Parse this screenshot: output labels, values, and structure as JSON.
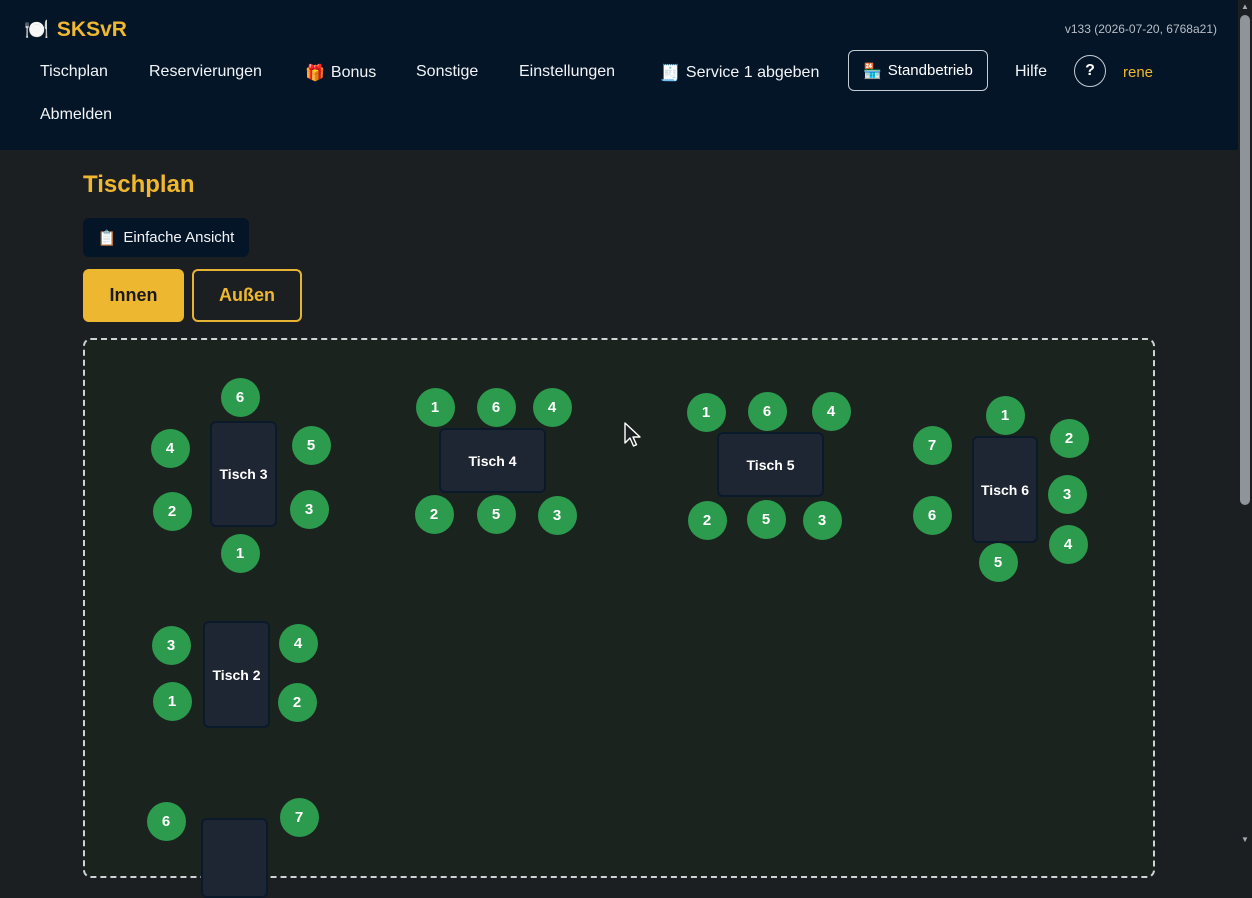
{
  "app": {
    "icon": "🍽️",
    "title": "SKSvR",
    "version": "v133 (2026-07-20, 6768a21)",
    "user": "rene"
  },
  "nav": {
    "tischplan": "Tischplan",
    "reservierungen": "Reservierungen",
    "bonus_icon": "🎁",
    "bonus": "Bonus",
    "sonstige": "Sonstige",
    "einstellungen": "Einstellungen",
    "service_icon": "🧾",
    "service": "Service 1 abgeben",
    "standbetrieb_icon": "🏪",
    "standbetrieb": "Standbetrieb",
    "hilfe": "Hilfe",
    "help_symbol": "?",
    "abmelden": "Abmelden"
  },
  "page": {
    "title": "Tischplan",
    "simple_view_icon": "📋",
    "simple_view": "Einfache Ansicht"
  },
  "tabs": {
    "innen": "Innen",
    "aussen": "Außen",
    "active": "innen"
  },
  "tables": {
    "t3": {
      "name": "Tisch 3",
      "seats": [
        "6",
        "4",
        "5",
        "2",
        "3",
        "1"
      ]
    },
    "t4": {
      "name": "Tisch 4",
      "seats": [
        "1",
        "6",
        "4",
        "2",
        "5",
        "3"
      ]
    },
    "t5": {
      "name": "Tisch 5",
      "seats": [
        "1",
        "6",
        "4",
        "2",
        "5",
        "3"
      ]
    },
    "t6": {
      "name": "Tisch 6",
      "seats": [
        "1",
        "2",
        "7",
        "3",
        "6",
        "4",
        "5"
      ]
    },
    "t2": {
      "name": "Tisch 2",
      "seats": [
        "3",
        "4",
        "1",
        "2"
      ]
    },
    "t7": {
      "seats": [
        "6",
        "7"
      ]
    }
  },
  "colors": {
    "accent": "#f0b731",
    "header": "#031527",
    "seat": "#2c9b4d",
    "table": "#1f2633"
  }
}
